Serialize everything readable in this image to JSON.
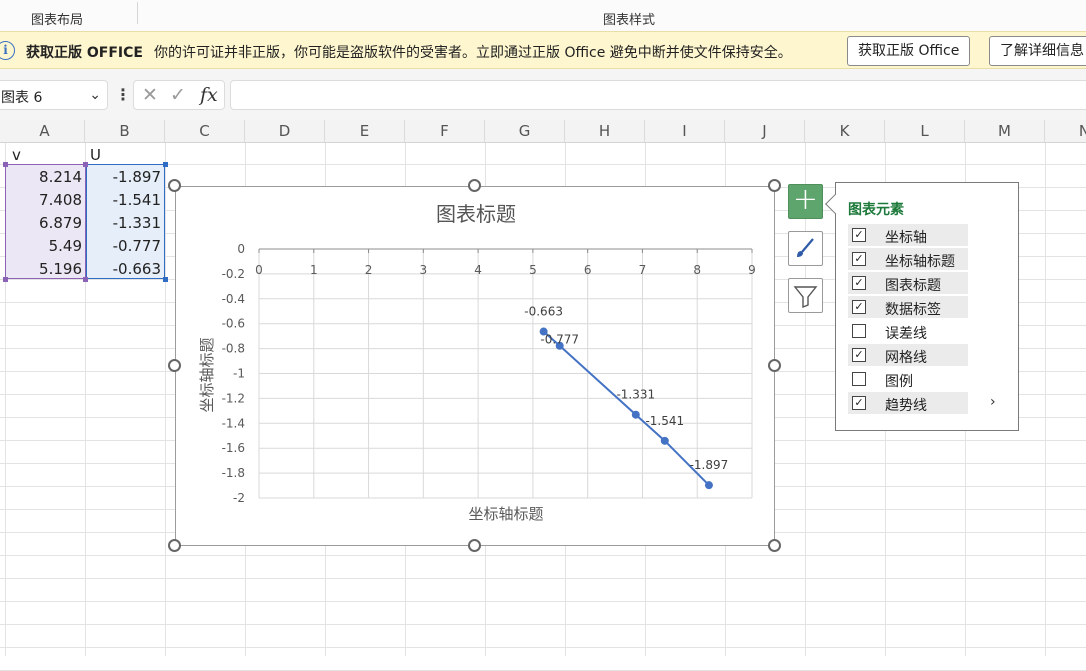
{
  "ribbon": {
    "groups": [
      "图表布局",
      "图表样式"
    ]
  },
  "license_bar": {
    "title": "获取正版 OFFICE",
    "message": "你的许可证并非正版，你可能是盗版软件的受害者。立即通过正版 Office 避免中断并使文件保持安全。",
    "button_primary": "获取正版 Office",
    "button_secondary": "了解详细信息",
    "icon": "info-icon"
  },
  "formula_bar": {
    "name_box": "图表 6",
    "cancel_glyph": "✕",
    "enter_glyph": "✓",
    "fx_glyph": "fx",
    "value": ""
  },
  "columns": [
    "A",
    "B",
    "C",
    "D",
    "E",
    "F",
    "G",
    "H",
    "I",
    "J",
    "K",
    "L",
    "M",
    "N"
  ],
  "sheet": {
    "headers": [
      "v",
      "U"
    ],
    "rows": [
      [
        "8.214",
        "-1.897"
      ],
      [
        "7.408",
        "-1.541"
      ],
      [
        "6.879",
        "-1.331"
      ],
      [
        "5.49",
        "-0.777"
      ],
      [
        "5.196",
        "-0.663"
      ]
    ]
  },
  "chart_data": {
    "type": "scatter",
    "title": "图表标题",
    "xlabel": "坐标轴标题",
    "ylabel": "坐标轴标题",
    "xlim": [
      0,
      9
    ],
    "ylim": [
      -2,
      0
    ],
    "x_ticks": [
      "0",
      "1",
      "2",
      "3",
      "4",
      "5",
      "6",
      "7",
      "8",
      "9"
    ],
    "y_ticks": [
      "0",
      "-0.2",
      "-0.4",
      "-0.6",
      "-0.8",
      "-1",
      "-1.2",
      "-1.4",
      "-1.6",
      "-1.8",
      "-2"
    ],
    "grid": true,
    "series": [
      {
        "x": [
          5.196,
          5.49,
          6.879,
          7.408,
          8.214
        ],
        "y": [
          -0.663,
          -0.777,
          -1.331,
          -1.541,
          -1.897
        ],
        "labels": [
          "-0.663",
          "-0.777",
          "-1.331",
          "-1.541",
          "-1.897"
        ],
        "color": "#4472c4",
        "line": true
      }
    ]
  },
  "chart_elements_panel": {
    "title": "图表元素",
    "items": [
      {
        "label": "坐标轴",
        "checked": true
      },
      {
        "label": "坐标轴标题",
        "checked": true
      },
      {
        "label": "图表标题",
        "checked": true
      },
      {
        "label": "数据标签",
        "checked": true
      },
      {
        "label": "误差线",
        "checked": false
      },
      {
        "label": "网格线",
        "checked": true
      },
      {
        "label": "图例",
        "checked": false
      },
      {
        "label": "趋势线",
        "checked": true,
        "submenu": true
      }
    ],
    "submenu_glyph": "›"
  },
  "side_buttons": [
    "plus-icon",
    "brush-icon",
    "filter-icon"
  ]
}
